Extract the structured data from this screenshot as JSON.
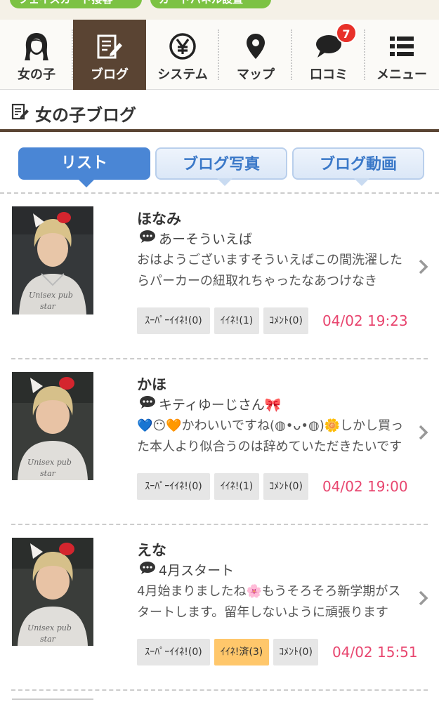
{
  "top_tags": [
    "フェイスカード接客",
    "カードパネル設置"
  ],
  "nav": [
    {
      "label": "女の子",
      "icon": "girl-icon"
    },
    {
      "label": "ブログ",
      "icon": "blog-edit-icon"
    },
    {
      "label": "システム",
      "icon": "yen-icon"
    },
    {
      "label": "マップ",
      "icon": "map-pin-icon"
    },
    {
      "label": "口コミ",
      "icon": "speech-bubble-icon",
      "badge": "7"
    },
    {
      "label": "メニュー",
      "icon": "menu-list-icon"
    }
  ],
  "section": {
    "title": "女の子ブログ",
    "icon": "blog-edit-icon"
  },
  "tabs": [
    {
      "label": "リスト",
      "active": true
    },
    {
      "label": "ブログ写真",
      "active": false
    },
    {
      "label": "ブログ動画",
      "active": false
    }
  ],
  "entries": [
    {
      "name": "ほなみ",
      "subject": "あーそういえば",
      "body": "おはようございますそういえばこの間洗濯したらパーカーの紐取れちゃったなあつけなき",
      "super_like": "ｽｰﾊﾟｰｲｲﾈ!(0)",
      "like": "ｲｲﾈ!(1)",
      "like_done": false,
      "comment": "ｺﾒﾝﾄ(0)",
      "date": "04/02 19:23"
    },
    {
      "name": "かほ",
      "subject": "キティゆーじさん🎀",
      "body": "💙😶🧡かわいいですね(◍•ᴗ•◍)🌼しかし買った本人より似合うのは辞めていただきたいです",
      "super_like": "ｽｰﾊﾟｰｲｲﾈ!(0)",
      "like": "ｲｲﾈ!(1)",
      "like_done": false,
      "comment": "ｺﾒﾝﾄ(0)",
      "date": "04/02 19:00"
    },
    {
      "name": "えな",
      "subject": "4月スタート",
      "body": "4月始まりましたね🌸もうそろそろ新学期がスタートします。留年しないように頑張ります",
      "super_like": "ｽｰﾊﾟｰｲｲﾈ!(0)",
      "like": "ｲｲﾈ!済(3)",
      "like_done": true,
      "comment": "ｺﾒﾝﾄ(0)",
      "date": "04/02 15:51"
    }
  ],
  "colors": {
    "brown": "#5a4433",
    "tab_active": "#4a86d5",
    "date": "#e8466f",
    "badge": "#e8312a",
    "like_done": "#ffc76b",
    "tag_green": "#7cc243"
  }
}
